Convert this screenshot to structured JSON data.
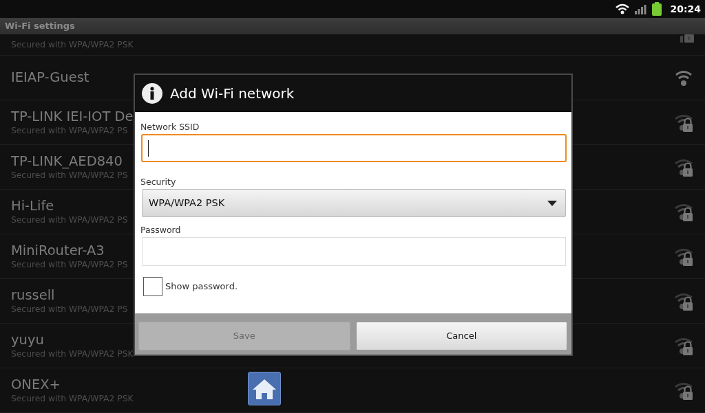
{
  "status_bar": {
    "time": "20:24"
  },
  "title": "Wi-Fi settings",
  "networks": [
    {
      "kind": "partial",
      "detail": "Secured with WPA/WPA2 PSK",
      "secured": true
    },
    {
      "kind": "full",
      "name": "IEIAP-Guest",
      "secured": false
    },
    {
      "kind": "full",
      "name": "TP-LINK IEI-IOT De",
      "detail": "Secured with WPA/WPA2 PS",
      "secured": true
    },
    {
      "kind": "full",
      "name": "TP-LINK_AED840",
      "detail": "Secured with WPA/WPA2 PS",
      "secured": true
    },
    {
      "kind": "full",
      "name": "Hi-Life",
      "detail": "Secured with WPA/WPA2 PS",
      "secured": true
    },
    {
      "kind": "full",
      "name": "MiniRouter-A3",
      "detail": "Secured with WPA/WPA2 PS",
      "secured": true
    },
    {
      "kind": "full",
      "name": "russell",
      "detail": "Secured with WPA/WPA2 PS",
      "secured": true
    },
    {
      "kind": "full",
      "name": "yuyu",
      "detail": "Secured with WPA/WPA2 PSK",
      "secured": true
    },
    {
      "kind": "full",
      "name": "ONEX+",
      "detail": "Secured with WPA/WPA2 PSK",
      "secured": true
    }
  ],
  "dialog": {
    "title": "Add Wi-Fi network",
    "ssid": {
      "label": "Network SSID",
      "focused": true
    },
    "security": {
      "label": "Security",
      "value": "WPA/WPA2 PSK"
    },
    "password": {
      "label": "Password"
    },
    "show_password": {
      "label": "Show password.",
      "checked": false
    },
    "buttons": [
      {
        "label": "Save",
        "disabled": true
      },
      {
        "label": "Cancel",
        "disabled": false
      }
    ]
  }
}
